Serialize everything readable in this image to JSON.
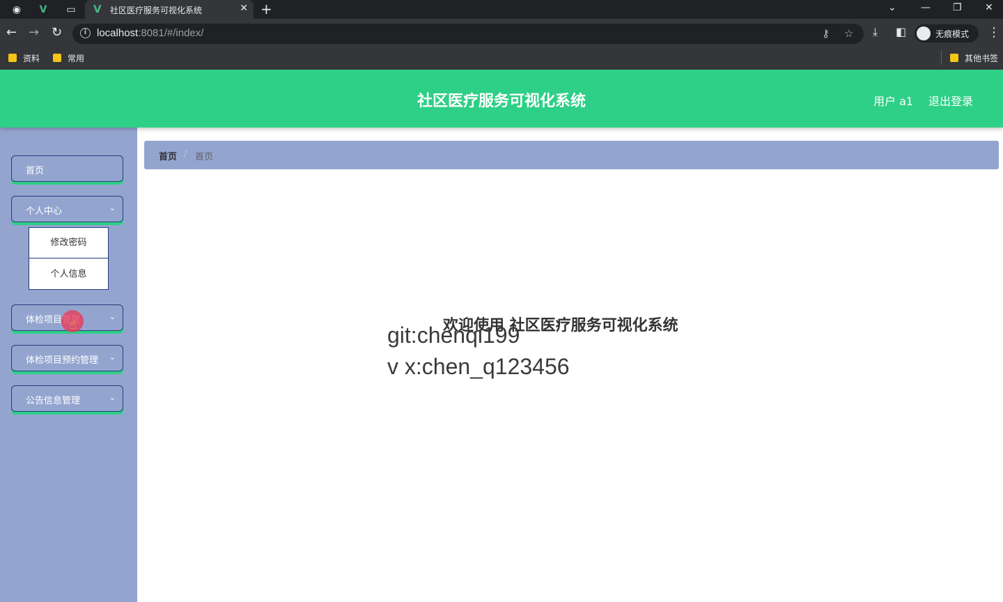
{
  "browser": {
    "tab_title": "社区医疗服务可视化系统",
    "url_host": "localhost",
    "url_rest": ":8081/#/index/",
    "incognito_label": "无痕模式",
    "bookmarks": [
      "资料",
      "常用"
    ],
    "other_bookmarks": "其他书签"
  },
  "header": {
    "title": "社区医疗服务可视化系统",
    "user_label": "用户 a1",
    "logout_label": "退出登录"
  },
  "sidebar": {
    "items": [
      {
        "label": "首页"
      },
      {
        "label": "个人中心"
      },
      {
        "label": "体检项目管理"
      },
      {
        "label": "体检项目预约管理"
      },
      {
        "label": "公告信息管理"
      }
    ],
    "submenu": [
      "修改密码",
      "个人信息"
    ]
  },
  "breadcrumb": {
    "home": "首页",
    "separator": "/",
    "current": "首页"
  },
  "main": {
    "welcome": "欢迎使用 社区医疗服务可视化系统",
    "watermark_line1": "git:chenqi199",
    "watermark_line2": "v x:chen_q123456"
  },
  "colors": {
    "header_bg": "#2ecf86",
    "sidebar_bg": "#93a5cf",
    "menu_border": "#253a7a"
  }
}
